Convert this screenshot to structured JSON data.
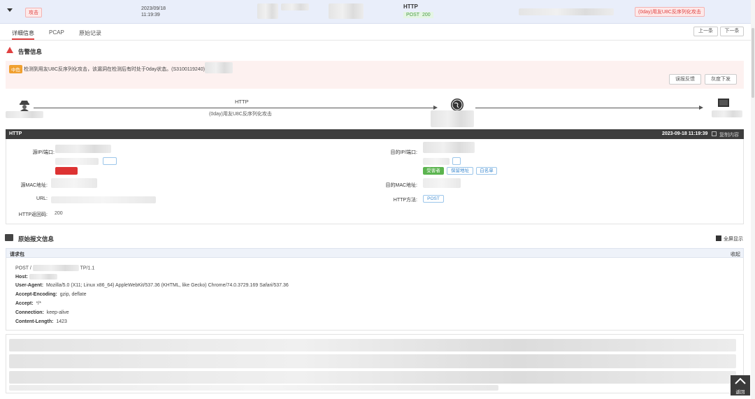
{
  "summary": {
    "attack_tag": "攻击",
    "date": "2023/09/18",
    "time": "11:19:39",
    "protocol": "HTTP",
    "method": "POST",
    "status": "200",
    "threat_tag": "(0day)用友U8C反序列化攻击"
  },
  "tabs": {
    "detail": "详细信息",
    "pcap": "PCAP",
    "raw": "原始记录"
  },
  "nav": {
    "prev": "上一条",
    "next": "下一条"
  },
  "alert": {
    "title": "告警信息",
    "level": "中危",
    "message": "检测到用友U8C反序列化攻击，该漏洞在检测后有时处于0day状态。(S3100119240)",
    "report_button": "误报反馈",
    "gray_button": "灰度下发"
  },
  "flow": {
    "protocol": "HTTP",
    "attack_name": "(0day)用友U8C反序列化攻击"
  },
  "http_panel": {
    "title": "HTTP",
    "timestamp": "2023-09-18 11:19:39",
    "copy_label": "复制内容",
    "src_ip_label": "源IP/端口:",
    "dst_ip_label": "目的IP/端口:",
    "src_mac_label": "源MAC地址:",
    "dst_mac_label": "目的MAC地址:",
    "url_label": "URL:",
    "method_label": "HTTP方法:",
    "method_value": "POST",
    "status_label": "HTTP返回码:",
    "status_value": "200",
    "victim_chip": "受害者",
    "protect_chip": "保留地址",
    "whitelist_chip": "白名单"
  },
  "raw": {
    "title": "原始报文信息",
    "fullscreen": "全屏显示",
    "request_label": "请求包",
    "collapse": "收起",
    "request_line": "POST /",
    "request_line_tail": "TP/1.1",
    "headers": [
      {
        "k": "Host:",
        "v": ""
      },
      {
        "k": "User-Agent:",
        "v": "Mozilla/5.0 (X11; Linux x86_64) AppleWebKit/537.36 (KHTML, like Gecko) Chrome/74.0.3729.169 Safari/537.36"
      },
      {
        "k": "Accept-Encoding:",
        "v": "gzip, deflate"
      },
      {
        "k": "Accept:",
        "v": "*/*"
      },
      {
        "k": "Connection:",
        "v": "keep-alive"
      },
      {
        "k": "Content-Length:",
        "v": "1423"
      }
    ]
  },
  "back_top": "返回"
}
